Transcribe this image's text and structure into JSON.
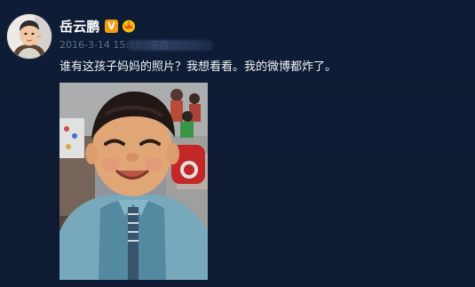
{
  "post": {
    "author_name": "岳云鹏",
    "verified_badge": "V",
    "timestamp": "2016-3-14 15:50",
    "source_prefix": "来自",
    "text": "谁有这孩子妈妈的照片？我想看看。我的微博都炸了。",
    "icons": [
      "verified-v-icon",
      "member-crown-icon"
    ],
    "colors": {
      "background": "#0e1a33",
      "name": "#ffffff",
      "meta": "#5d6f8d",
      "verified_badge": "#f39c12"
    }
  }
}
